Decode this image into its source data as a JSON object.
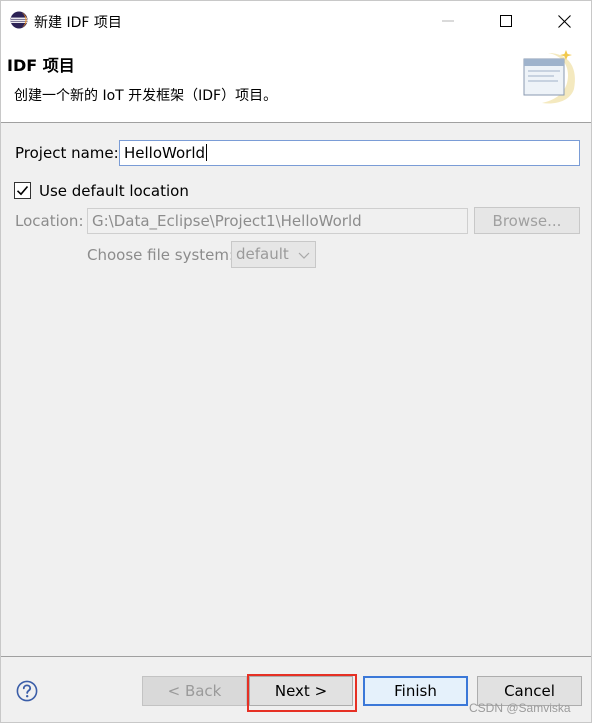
{
  "window": {
    "title": "新建 IDF 项目"
  },
  "banner": {
    "title": "IDF 项目",
    "description": "创建一个新的 IoT 开发框架（IDF）项目。"
  },
  "form": {
    "project_name_label": "Project name:",
    "project_name_value": "HelloWorld",
    "use_default_location_label": "Use default location",
    "use_default_location_checked": true,
    "location_label": "Location:",
    "location_value": "G:\\Data_Eclipse\\Project1\\HelloWorld",
    "browse_label": "Browse...",
    "file_system_label": "Choose file system:",
    "file_system_value": "default"
  },
  "footer": {
    "back_label": "< Back",
    "next_label": "Next >",
    "finish_label": "Finish",
    "cancel_label": "Cancel"
  },
  "watermark": "CSDN @Samviska",
  "colors": {
    "accent": "#3b78d8",
    "highlight": "#e63024",
    "dialog_bg": "#f0f0f0"
  },
  "icons": {
    "app": "eclipse-icon",
    "help": "help-icon",
    "banner": "new-project-wizard-icon"
  }
}
